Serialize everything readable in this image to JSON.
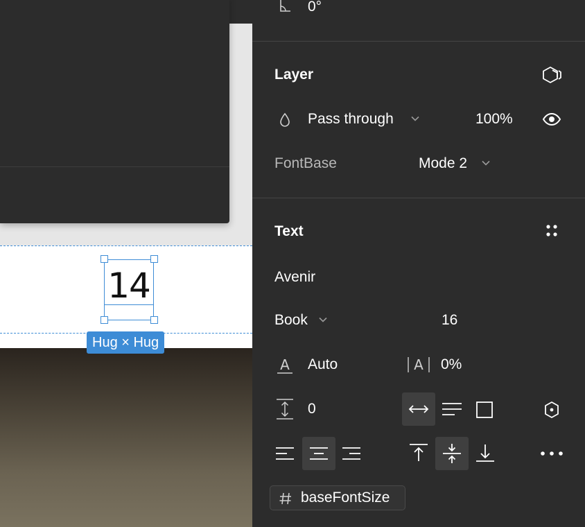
{
  "canvas": {
    "selection_text": "14",
    "hug_label": "Hug × Hug"
  },
  "panel": {
    "rotation": {
      "value": "0°",
      "icon": "angle-icon"
    },
    "layer": {
      "title": "Layer",
      "blend_mode": "Pass through",
      "opacity": "100%",
      "variable_name": "FontBase",
      "variable_mode": "Mode 2"
    },
    "text": {
      "title": "Text",
      "font_family": "Avenir",
      "font_style": "Book",
      "font_size": "16",
      "line_height": "Auto",
      "letter_spacing": "0%",
      "paragraph_spacing": "0",
      "variable_chip": "baseFontSize"
    }
  },
  "colors": {
    "panel_bg": "#2c2c2c",
    "selection_blue": "#3d8cd6",
    "active_button_bg": "#3f3f3f"
  }
}
